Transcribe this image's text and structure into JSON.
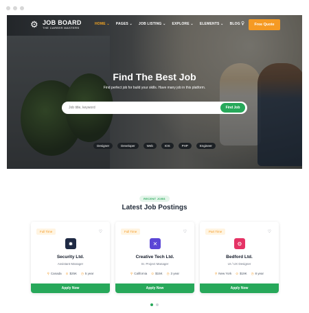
{
  "nav": {
    "logo_title": "JOB BOARD",
    "logo_subtitle": "THE CAREER MASTERS",
    "logo_icon": "gear-icon",
    "items": [
      {
        "label": "HOME ⌄",
        "active": true
      },
      {
        "label": "PAGES ⌄",
        "active": false
      },
      {
        "label": "JOB LISTING ⌄",
        "active": false
      },
      {
        "label": "EXPLORE ⌄",
        "active": false
      },
      {
        "label": "ELEMENTS ⌄",
        "active": false
      },
      {
        "label": "BLOG ⌄",
        "active": false
      }
    ],
    "quote_label": "Free Quote",
    "accent": "#f59a23"
  },
  "hero": {
    "title": "Find The Best Job",
    "subtitle": "Find perfect job for build your skills. Have many job in this platform.",
    "search_placeholder": "Job title, keyword",
    "find_label": "Find Job",
    "tags": [
      "Designer",
      "Developer",
      "Web",
      "IOS",
      "PHP",
      "Engineer"
    ]
  },
  "section": {
    "badge": "RECENT JOBS",
    "title": "Latest Job Postings"
  },
  "jobs": [
    {
      "type": "Full Time",
      "company": "Security Ltd.",
      "title": "Assistant Manager",
      "location": "Canada",
      "salary": "$25K",
      "experience": "5 year",
      "logo_color": "#1f2a44",
      "logo_icon": "gear-icon"
    },
    {
      "type": "Full Time",
      "company": "Creative Tech Ltd.",
      "title": "Sr. Project Manager",
      "location": "California",
      "salary": "$15K",
      "experience": "3 year",
      "logo_color": "#5b46d6",
      "logo_icon": "cross-icon"
    },
    {
      "type": "Part Time",
      "company": "Bedford Ltd.",
      "title": "UI / UX Designer",
      "location": "New York",
      "salary": "$19K",
      "experience": "8 year",
      "logo_color": "#e53365",
      "logo_icon": "cog-icon"
    }
  ],
  "apply_label": "Apply Now",
  "colors": {
    "green": "#27a85a",
    "orange": "#f59a23"
  }
}
